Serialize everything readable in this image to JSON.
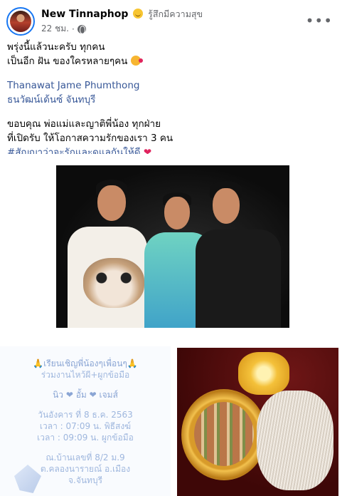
{
  "post": {
    "author": "New Tinnaphop",
    "feeling": "รู้สึกมีความสุข",
    "time": "22 ชม.",
    "separator": "·",
    "more_icon": "more-horizontal-icon",
    "privacy_icon": "globe-icon"
  },
  "body": {
    "line1": "พรุ่งนี้แล้วนะครับ ทุกคน",
    "line2": "เป็นอีก ฝัน ของใครหลายๆคน",
    "tag_name": "Thanawat Jame Phumthong",
    "tag_place": "ธนวัฒน์เด้นซ์ จันทบุรี",
    "line3": "ขอบคุณ พ่อแม่และญาติพี่น้อง ทุกฝ่าย",
    "line4": "ที่เปิดรับ ให้โอกาสความรักของเรา 3 คน",
    "hashtag": "#สัญญาว่าจะรักและดูแลกันให้ดี",
    "heart": "❤"
  },
  "invite": {
    "title": "🙏เรียนเชิญพี่น้องๆเพื่อนๆ🙏",
    "subtitle": "ร่วมงานไหว้ผี+ผูกข้อมือ",
    "names": "นิว ❤ อั้ม ❤ เจมส์",
    "date": "วันอังคาร ที่ 8 ธ.ค. 2563",
    "time1": "เวลา : 07:09 น. พิธีสงฆ์",
    "time2": "เวลา : 09:09 น. ผูกข้อมือ",
    "place1": "ณ.บ้านเลขที่ 8/2 ม.9",
    "place2": "ต.คลองนารายณ์ อ.เมือง",
    "place3": "จ.จันทบุรี"
  },
  "colors": {
    "link": "#385898",
    "meta": "#65676b",
    "heart": "#e0245e"
  }
}
